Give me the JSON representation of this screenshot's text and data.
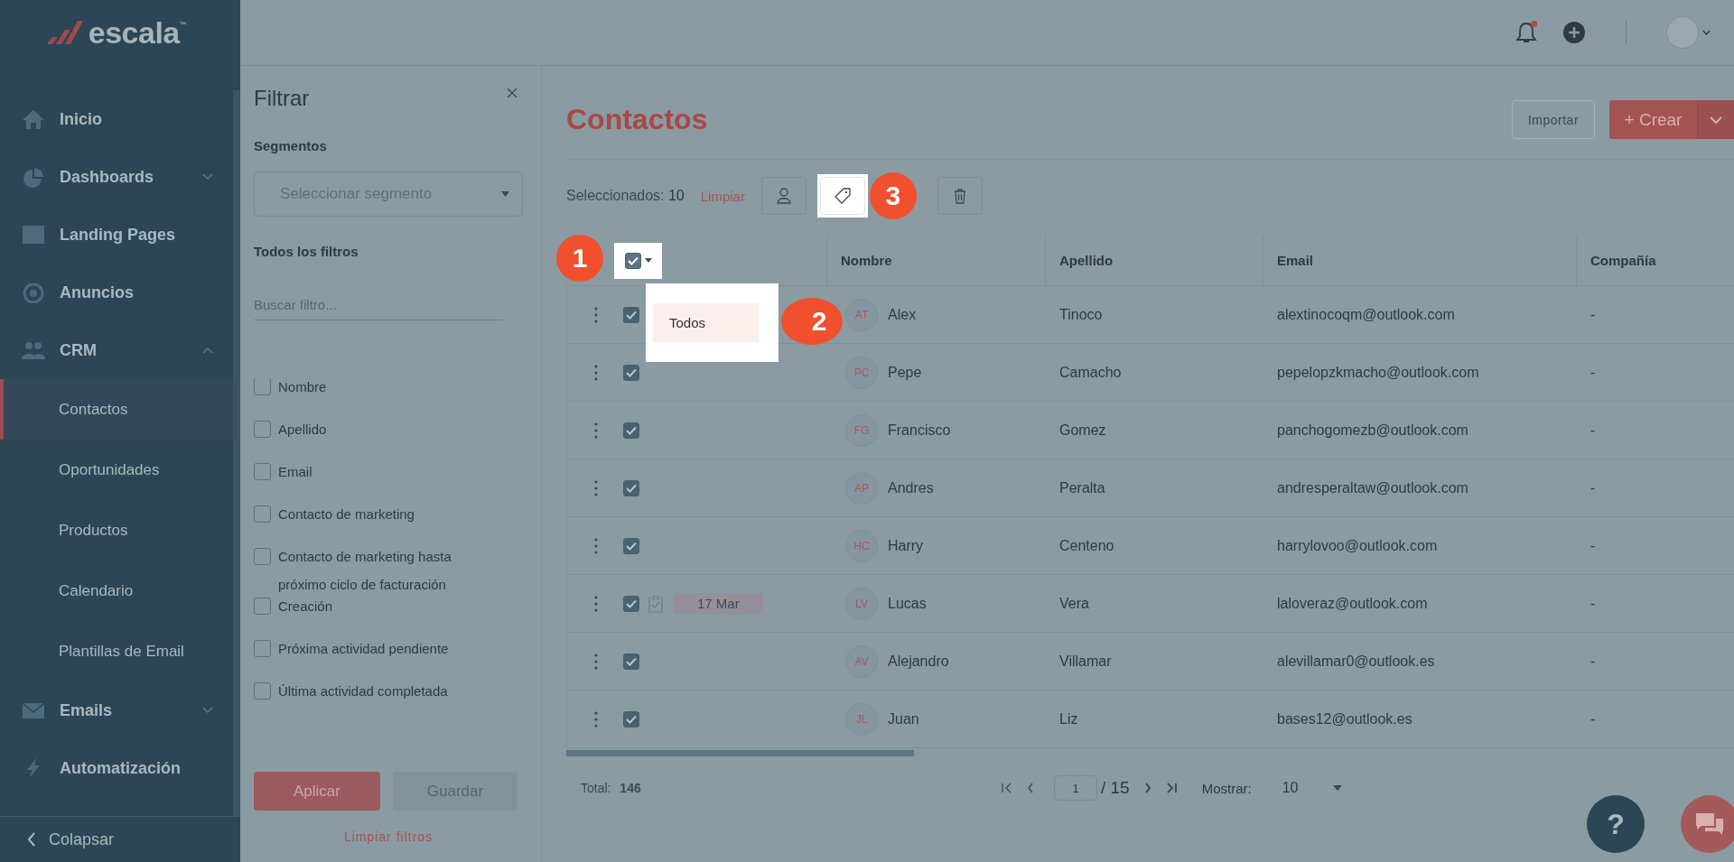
{
  "sidebar": {
    "logo": "escala",
    "logo_mark": "™",
    "items": [
      {
        "label": "Inicio",
        "kind": "link"
      },
      {
        "label": "Dashboards",
        "kind": "group",
        "expanded": false
      },
      {
        "label": "Landing Pages",
        "kind": "link"
      },
      {
        "label": "Anuncios",
        "kind": "link"
      },
      {
        "label": "CRM",
        "kind": "group",
        "expanded": true,
        "children": [
          {
            "label": "Contactos",
            "selected": true
          },
          {
            "label": "Oportunidades",
            "selected": false
          },
          {
            "label": "Productos",
            "selected": false
          },
          {
            "label": "Calendario",
            "selected": false
          },
          {
            "label": "Plantillas de Email",
            "selected": false
          }
        ]
      },
      {
        "label": "Emails",
        "kind": "group",
        "expanded": false
      },
      {
        "label": "Automatización",
        "kind": "link"
      }
    ],
    "collapse": "Colapsar"
  },
  "header": {
    "notification": true
  },
  "filter_panel": {
    "title": "Filtrar",
    "segments_label": "Segmentos",
    "segment_select": {
      "placeholder": "Seleccionar segmento"
    },
    "all_filters_label": "Todos los filtros",
    "search": {
      "placeholder": "Buscar filtro..."
    },
    "filters": [
      {
        "label": "Nombre",
        "checked": false
      },
      {
        "label": "Apellido",
        "checked": false
      },
      {
        "label": "Email",
        "checked": false
      },
      {
        "label": "Contacto de marketing",
        "checked": false
      },
      {
        "label": "Contacto de marketing hasta próximo ciclo de facturación",
        "checked": false
      },
      {
        "label": "Creación",
        "checked": false
      },
      {
        "label": "Próxima actividad pendiente",
        "checked": false
      },
      {
        "label": "Última actividad completada",
        "checked": false
      }
    ],
    "apply": "Aplicar",
    "save": {
      "label": "Guardar",
      "disabled": true
    },
    "clear": "Limpiar filtros"
  },
  "main": {
    "title": "Contactos",
    "import": "Importar",
    "create": "+ Crear",
    "selection": {
      "label": "Seleccionados:",
      "count": "10",
      "clear": "Limpiar"
    },
    "table": {
      "columns": [
        "Nombre",
        "Apellido",
        "Email",
        "Compañía"
      ],
      "header_checked": true,
      "rows": [
        {
          "initials": "AT",
          "name": "Alex",
          "surname": "Tinoco",
          "email": "alextinocoqm@outlook.com",
          "company": "-",
          "checked": true
        },
        {
          "initials": "PC",
          "name": "Pepe",
          "surname": "Camacho",
          "email": "pepelopzkmacho@outlook.com",
          "company": "-",
          "checked": true
        },
        {
          "initials": "FG",
          "name": "Francisco",
          "surname": "Gomez",
          "email": "panchogomezb@outlook.com",
          "company": "-",
          "checked": true
        },
        {
          "initials": "AP",
          "name": "Andres",
          "surname": "Peralta",
          "email": "andresperaltaw@outlook.com",
          "company": "-",
          "checked": true
        },
        {
          "initials": "HC",
          "name": "Harry",
          "surname": "Centeno",
          "email": "harrylovoo@outlook.com",
          "company": "-",
          "checked": true
        },
        {
          "initials": "LV",
          "name": "Lucas",
          "surname": "Vera",
          "email": "laloveraz@outlook.com",
          "company": "-",
          "checked": true,
          "task_date": "17 Mar"
        },
        {
          "initials": "AV",
          "name": "Alejandro",
          "surname": "Villamar",
          "email": "alevillamar0@outlook.es",
          "company": "-",
          "checked": true
        },
        {
          "initials": "JL",
          "name": "Juan",
          "surname": "Liz",
          "email": "bases12@outlook.es",
          "company": "-",
          "checked": true
        }
      ]
    },
    "select_menu": [
      {
        "label": "Todos",
        "selected": true
      }
    ],
    "callouts": [
      "1",
      "2",
      "3"
    ],
    "footer": {
      "total_label": "Total:",
      "total": "146",
      "page": "1",
      "pages": "/ 15",
      "show_label": "Mostrar:",
      "show_value": "10"
    },
    "help": "?"
  }
}
